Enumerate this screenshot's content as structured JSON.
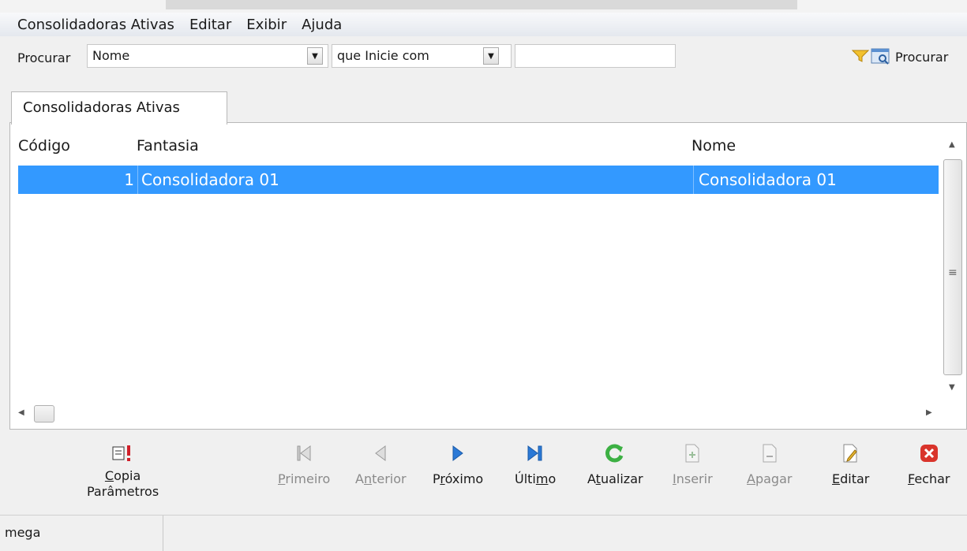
{
  "menu": [
    "Consolidadoras Ativas",
    "Editar",
    "Exibir",
    "Ajuda"
  ],
  "search": {
    "label": "Procurar",
    "field_value": "Nome",
    "condition_value": "que Inicie com",
    "text_value": "",
    "button_label": "Procurar"
  },
  "tab": {
    "label": "Consolidadoras Ativas"
  },
  "grid": {
    "columns": [
      "Código",
      "Fantasia",
      "Nome"
    ],
    "rows": [
      {
        "codigo": "1",
        "fantasia": "Consolidadora 01",
        "nome": "Consolidadora 01",
        "selected": true
      }
    ]
  },
  "toolbar": {
    "copia_line1": "Copia",
    "copia_line2": "Parâmetros",
    "primeiro": "Primeiro",
    "anterior": "Anterior",
    "proximo": "Próximo",
    "ultimo": "Último",
    "atualizar": "Atualizar",
    "inserir": "Inserir",
    "apagar": "Apagar",
    "editar": "Editar",
    "fechar": "Fechar"
  },
  "status": {
    "user": "mega"
  },
  "colors": {
    "selection": "#3399ff",
    "refresh": "#3cb043",
    "close": "#d9342b",
    "nav": "#2b79d6"
  }
}
